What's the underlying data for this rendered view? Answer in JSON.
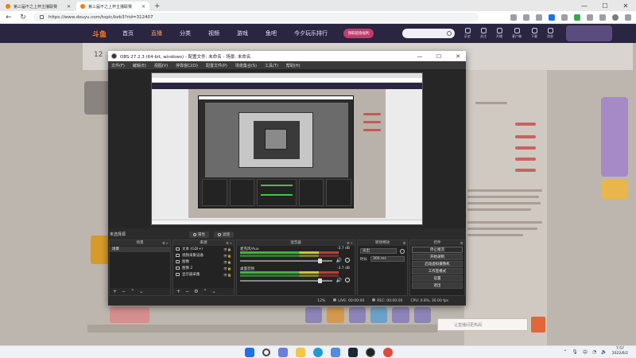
{
  "browser": {
    "tabs": [
      {
        "label": "第三届不之上杯主播联赛",
        "active": false
      },
      {
        "label": "第三届不之上杯主播联赛",
        "active": true
      }
    ],
    "new_tab": "+",
    "window_controls": {
      "minimize": "—",
      "maximize": "☐",
      "close": "✕"
    },
    "url": "https://www.douyu.com/topic/bzb3?rid=312407"
  },
  "site": {
    "logo": "斗鱼",
    "nav": [
      "首页",
      "直播",
      "分类",
      "视频",
      "游戏",
      "鱼吧",
      "今夕玩乐排行"
    ],
    "active_nav": "直播",
    "promo": "领取超值福利",
    "header_icons": [
      "历史",
      "关注",
      "开播",
      "客户端",
      "下载",
      "消息"
    ],
    "room_number": "12",
    "chat_placeholder": "让直播间更热闹"
  },
  "obs": {
    "title": "OBS 27.2.3 (64-bit, windows) - 配置文件: 未命名 - 场景: 未命名",
    "menu": [
      "文件(F)",
      "编辑(E)",
      "视图(V)",
      "停靠窗口(D)",
      "配置文件(P)",
      "场景集合(S)",
      "工具(T)",
      "帮助(H)"
    ],
    "no_source": "未选择源",
    "props_btn": "属性",
    "filters_btn": "滤镜",
    "docks": {
      "scenes": {
        "header": "场景",
        "items": [
          "场景"
        ]
      },
      "sources": {
        "header": "来源",
        "items": [
          {
            "label": "文本 (GDI+)",
            "icon": "text-icon"
          },
          {
            "label": "视频采集设备",
            "icon": "camera-icon"
          },
          {
            "label": "图像",
            "icon": "image-icon"
          },
          {
            "label": "图像 2",
            "icon": "image-icon"
          },
          {
            "label": "显示器采集",
            "icon": "monitor-icon"
          }
        ]
      },
      "mixer": {
        "header": "混音器",
        "tracks": [
          {
            "name": "麦克风/Aux",
            "db": "-3.7 dB"
          },
          {
            "name": "桌面音频",
            "db": "-3.7 dB"
          }
        ]
      },
      "transitions": {
        "header": "转场特效",
        "selected": "淡出",
        "duration_label": "时长",
        "duration_value": "300 ms"
      },
      "controls": {
        "header": "控件",
        "buttons": [
          "停止推流",
          "开始录制",
          "启动虚拟摄像机",
          "工作室模式",
          "设置",
          "退出"
        ]
      }
    },
    "status": {
      "live": "LIVE: 00:00:00",
      "rec": "REC: 00:00:00",
      "cpu": "CPU: 0.8%, 30.00 fps",
      "dropped": "12%"
    }
  },
  "taskbar": {
    "time": "7:57",
    "date": "2022/6/2",
    "lang": "中"
  }
}
